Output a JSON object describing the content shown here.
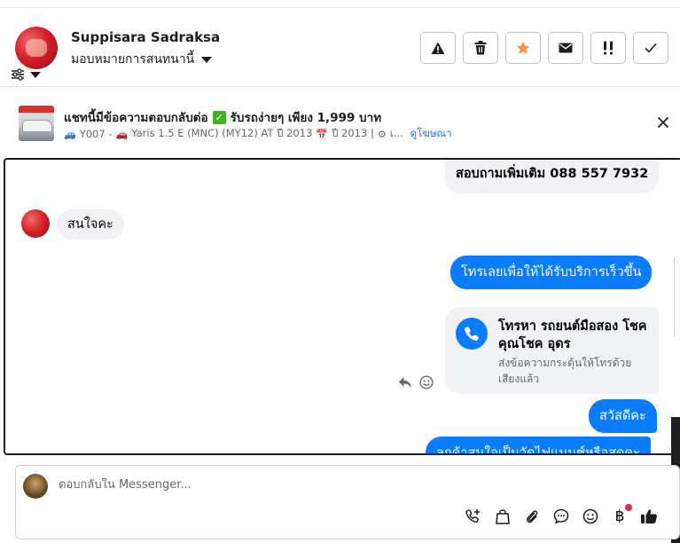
{
  "header": {
    "contact_name": "Suppisara Sadraksa",
    "assign_label": "มอบหมายการสนทนานี้",
    "actions": [
      {
        "name": "report-button",
        "icon": "warning-icon"
      },
      {
        "name": "delete-button",
        "icon": "trash-icon"
      },
      {
        "name": "star-button",
        "icon": "star-icon"
      },
      {
        "name": "mark-unread-button",
        "icon": "envelope-icon"
      },
      {
        "name": "mark-spam-button",
        "icon": "exclamation-icon"
      },
      {
        "name": "mark-done-button",
        "icon": "check-icon"
      }
    ]
  },
  "ad": {
    "title": "แชทนี้มีข้อความตอบกลับต่อ ✅ รับรถง่ายๆ เพียง 1,999 บาท",
    "title_before": "แชทนี้มีข้อความตอบกลับต่อ",
    "title_after": "รับรถง่ายๆ เพียง 1,999 บาท",
    "sub_code": "Y007 -",
    "sub_model": "Yaris 1.5 E (MNC) (MY12) AT ปี 2013",
    "sub_year": "ปี 2013 |",
    "sub_trunc": "เ...",
    "view_ad_link": "ดูโฆษณา"
  },
  "messages": {
    "m1": "สอบถามเพิ่มเติม 088 557 7932",
    "m2": "สนใจคะ",
    "m3": "โทรเลยเพื่อให้ได้รับบริการเร็วขึ้น",
    "call_title": "โทรหา รถยนต์มือสอง โชคคุณโชค อุดร",
    "call_sub": "ส่งข้อความกระตุ้นให้โทรด้วยเสียงแล้ว",
    "m4": "สวัสดีคะ",
    "m5": "ลูกค้าสนใจเป็นวัดไฟแนนซ์หรือสดคะ"
  },
  "composer": {
    "placeholder": "ตอบกลับใน Messenger...",
    "tools": [
      "add-call-icon",
      "shopping-bag-icon",
      "paperclip-icon",
      "chat-bubble-icon",
      "emoji-icon",
      "baht-icon",
      "thumbs-up-icon"
    ]
  },
  "colors": {
    "accent": "#0a7cff",
    "star": "#f7923b",
    "bubble_grey": "#f0f2f5",
    "link": "#1877f2"
  }
}
